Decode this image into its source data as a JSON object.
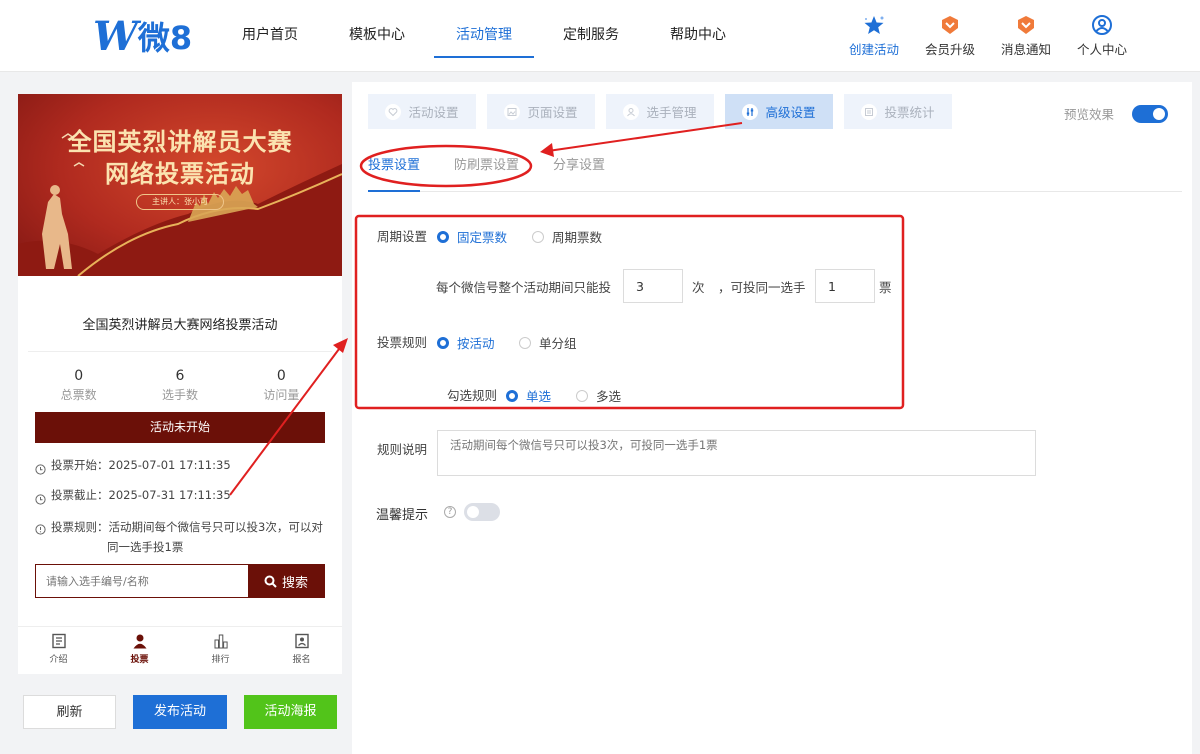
{
  "header": {
    "logo_mark": "W",
    "logo_text": "微8",
    "nav": [
      "用户首页",
      "模板中心",
      "活动管理",
      "定制服务",
      "帮助中心"
    ],
    "right_buttons": [
      "创建活动",
      "会员升级",
      "消息通知",
      "个人中心"
    ]
  },
  "preview": {
    "banner_title_1": "全国英烈讲解员大赛",
    "banner_title_2": "网络投票活动",
    "banner_speaker": "主讲人：张小可",
    "activity_title": "全国英烈讲解员大赛网络投票活动",
    "stats": [
      {
        "value": "0",
        "label": "总票数"
      },
      {
        "value": "6",
        "label": "选手数"
      },
      {
        "value": "0",
        "label": "访问量"
      }
    ],
    "status": "活动未开始",
    "vote_start": "投票开始：2025-07-01 17:11:35",
    "vote_end": "投票截止：2025-07-31 17:11:35",
    "vote_rule_1": "投票规则：活动期间每个微信号只可以投3次，可以对",
    "vote_rule_2": "同一选手投1票",
    "search_placeholder": "请输入选手编号/名称",
    "search_button": "搜索",
    "bottom_tabs": [
      "介绍",
      "投票",
      "排行",
      "报名"
    ]
  },
  "actions": {
    "refresh": "刷新",
    "publish": "发布活动",
    "poster": "活动海报"
  },
  "steps": [
    "活动设置",
    "页面设置",
    "选手管理",
    "高级设置",
    "投票统计"
  ],
  "preview_toggle_label": "预览效果",
  "subtabs": [
    "投票设置",
    "防刷票设置",
    "分享设置"
  ],
  "form": {
    "cycle_label": "周期设置",
    "cycle_opt_fixed": "固定票数",
    "cycle_opt_period": "周期票数",
    "limit_prefix": "每个微信号整个活动期间只能投",
    "limit_times": "3",
    "limit_times_unit": "次",
    "limit_mid": "，可投同一选手",
    "limit_same": "1",
    "limit_same_unit": "票",
    "rule_label": "投票规则",
    "rule_opt_activity": "按活动",
    "rule_opt_group": "单分组",
    "select_label": "勾选规则",
    "select_opt_single": "单选",
    "select_opt_multi": "多选",
    "desc_label": "规则说明",
    "desc_placeholder": "活动期间每个微信号只可以投3次，可投同一选手1票",
    "tip_label": "温馨提示"
  },
  "colors": {
    "primary": "#1e6fd6",
    "brand_dark_red": "#6b1008",
    "success": "#52c41a",
    "annotation_red": "#e02020"
  }
}
